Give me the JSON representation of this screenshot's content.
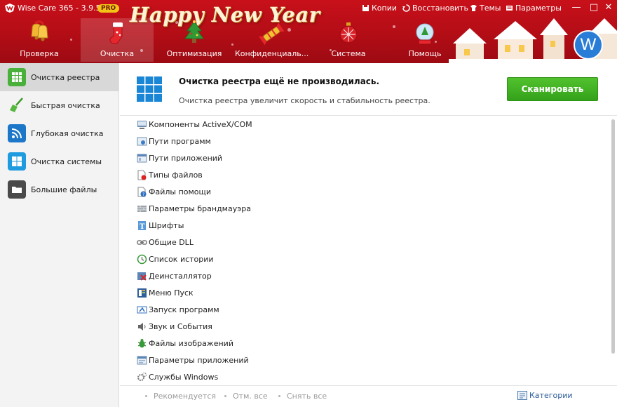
{
  "app": {
    "title": "Wise Care 365 - 3.9.5",
    "badge": "PRO",
    "banner": "Happy New Year",
    "avatar_letter": "W"
  },
  "top_actions": [
    {
      "label": "Копии",
      "icon": "backup-icon"
    },
    {
      "label": "Восстановить",
      "icon": "restore-icon"
    },
    {
      "label": "Темы",
      "icon": "themes-icon"
    },
    {
      "label": "Параметры",
      "icon": "settings-icon"
    }
  ],
  "nav": [
    {
      "label": "Проверка",
      "icon": "bells-icon"
    },
    {
      "label": "Очистка",
      "icon": "stocking-icon",
      "active": true
    },
    {
      "label": "Оптимизация",
      "icon": "christmas-tree-icon"
    },
    {
      "label": "Конфиденциаль...",
      "icon": "cracker-icon"
    },
    {
      "label": "Система",
      "icon": "ornament-icon"
    },
    {
      "label": "Помощь",
      "icon": "snow-globe-icon"
    }
  ],
  "sidebar": {
    "items": [
      {
        "label": "Очистка реестра",
        "icon": "registry-icon",
        "active": true
      },
      {
        "label": "Быстрая очистка",
        "icon": "broom-icon"
      },
      {
        "label": "Глубокая очистка",
        "icon": "deep-clean-icon"
      },
      {
        "label": "Очистка системы",
        "icon": "windows-icon"
      },
      {
        "label": "Большие файлы",
        "icon": "folder-icon"
      }
    ]
  },
  "info": {
    "title": "Очистка реестра ещё не производилась.",
    "description": "Очистка реестра увеличит скорость и стабильность реестра.",
    "scan_label": "Сканировать"
  },
  "categories": [
    {
      "label": "Компоненты ActiveX/COM",
      "icon": "activex-icon"
    },
    {
      "label": "Пути программ",
      "icon": "program-paths-icon"
    },
    {
      "label": "Пути приложений",
      "icon": "app-paths-icon"
    },
    {
      "label": "Типы файлов",
      "icon": "file-types-icon"
    },
    {
      "label": "Файлы помощи",
      "icon": "help-files-icon"
    },
    {
      "label": "Параметры брандмауэра",
      "icon": "firewall-icon"
    },
    {
      "label": "Шрифты",
      "icon": "fonts-icon"
    },
    {
      "label": "Общие DLL",
      "icon": "dll-icon"
    },
    {
      "label": "Список истории",
      "icon": "history-icon"
    },
    {
      "label": "Деинсталлятор",
      "icon": "uninstaller-icon"
    },
    {
      "label": "Меню Пуск",
      "icon": "start-menu-icon"
    },
    {
      "label": "Запуск программ",
      "icon": "startup-icon"
    },
    {
      "label": "Звук и События",
      "icon": "sound-icon"
    },
    {
      "label": "Файлы изображений",
      "icon": "image-files-icon"
    },
    {
      "label": "Параметры приложений",
      "icon": "app-settings-icon"
    },
    {
      "label": "Службы Windows",
      "icon": "services-icon"
    }
  ],
  "footer": {
    "recommended": "Рекомендуется",
    "select_all": "Отм. все",
    "deselect_all": "Снять все",
    "categories": "Категории"
  },
  "colors": {
    "header": "#c8101a",
    "scan_button": "#3fae22",
    "link": "#2d5d9a"
  }
}
